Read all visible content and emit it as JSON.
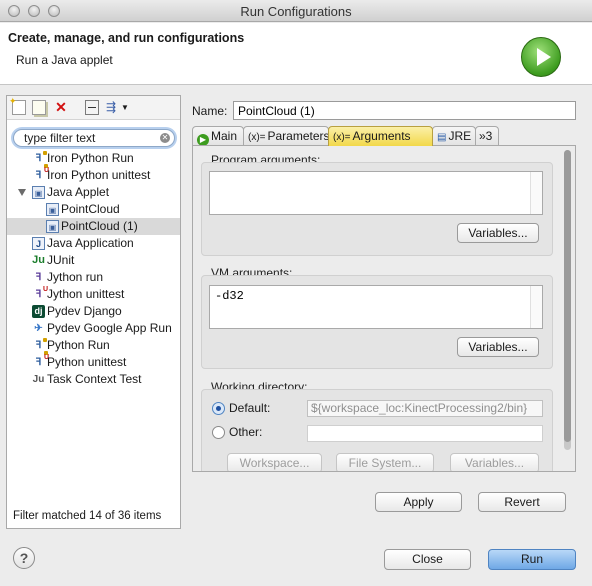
{
  "window": {
    "title": "Run Configurations"
  },
  "banner": {
    "title": "Create, manage, and run configurations",
    "description": "Run a Java applet",
    "icon": "run-icon"
  },
  "left_panel": {
    "toolbar": [
      "new-launch-config-icon",
      "duplicate-icon",
      "delete-icon",
      "collapse-all-icon",
      "filter-icon"
    ],
    "filter_placeholder": "type filter text",
    "filter_value": "type filter text",
    "tree": [
      {
        "label": "Iron Python Run",
        "icon": "python-icon",
        "level": 0
      },
      {
        "label": "Iron Python unittest",
        "icon": "python-unittest-icon",
        "level": 0
      },
      {
        "label": "Java Applet",
        "icon": "java-applet-icon",
        "level": 0,
        "expanded": true
      },
      {
        "label": "PointCloud",
        "icon": "java-applet-icon",
        "level": 1
      },
      {
        "label": "PointCloud (1)",
        "icon": "java-applet-icon",
        "level": 1,
        "selected": true
      },
      {
        "label": "Java Application",
        "icon": "java-application-icon",
        "level": 0
      },
      {
        "label": "JUnit",
        "icon": "junit-icon",
        "level": 0
      },
      {
        "label": "Jython run",
        "icon": "jython-icon",
        "level": 0
      },
      {
        "label": "Jython unittest",
        "icon": "jython-unittest-icon",
        "level": 0
      },
      {
        "label": "Pydev Django",
        "icon": "django-icon",
        "level": 0
      },
      {
        "label": "Pydev Google App Run",
        "icon": "google-app-engine-icon",
        "level": 0
      },
      {
        "label": "Python Run",
        "icon": "python-icon",
        "level": 0
      },
      {
        "label": "Python unittest",
        "icon": "python-unittest-icon",
        "level": 0
      },
      {
        "label": "Task Context Test",
        "icon": "task-context-icon",
        "level": 0
      }
    ],
    "status": "Filter matched 14 of 36 items"
  },
  "config": {
    "name_label": "Name:",
    "name_value": "PointCloud (1)",
    "tabs": [
      {
        "label": "Main",
        "icon": "run-icon"
      },
      {
        "label": "Parameters",
        "icon": "x-equals-icon"
      },
      {
        "label": "Arguments",
        "icon": "x-equals-icon",
        "active": true
      },
      {
        "label": "JRE",
        "icon": "jre-icon"
      },
      {
        "label": "»3",
        "icon": "overflow-icon"
      }
    ],
    "program_args": {
      "label": "Program arguments:",
      "value": "",
      "variables_button": "Variables..."
    },
    "vm_args": {
      "label": "VM arguments:",
      "value": "-d32",
      "variables_button": "Variables..."
    },
    "working_dir": {
      "label": "Working directory:",
      "default_label": "Default:",
      "default_value": "${workspace_loc:KinectProcessing2/bin}",
      "other_label": "Other:",
      "other_value": "",
      "selected": "default",
      "buttons": [
        "Workspace...",
        "File System...",
        "Variables..."
      ]
    },
    "apply": "Apply",
    "revert": "Revert"
  },
  "footer": {
    "close": "Close",
    "run": "Run",
    "help_icon": "help-icon"
  },
  "colors": {
    "selection": "#d9d9d9",
    "active_tab": "#f2d84a",
    "run_green": "#3d9c1f",
    "primary_button": "#6fa8e6"
  }
}
